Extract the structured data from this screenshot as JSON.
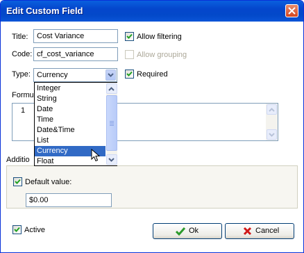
{
  "window": {
    "title": "Edit Custom Field"
  },
  "form": {
    "title_label": "Title:",
    "title_value": "Cost Variance",
    "code_label": "Code:",
    "code_value": "cf_cost_variance",
    "type_label": "Type:",
    "type_value": "Currency",
    "allow_filtering": {
      "label": "Allow filtering",
      "checked": true
    },
    "allow_grouping": {
      "label": "Allow grouping",
      "checked": false,
      "disabled": true
    },
    "required": {
      "label": "Required",
      "checked": true
    },
    "formula_label": "Formul",
    "formula_text": "1",
    "additional_label": "Additio",
    "default_value": {
      "label": "Default value:",
      "checked": true,
      "value": "$0.00"
    },
    "active": {
      "label": "Active",
      "checked": true
    }
  },
  "type_dropdown": {
    "options": [
      "Integer",
      "String",
      "Date",
      "Time",
      "Date&Time",
      "List",
      "Currency",
      "Float"
    ],
    "selected": "Currency"
  },
  "buttons": {
    "ok_label": "Ok",
    "cancel_label": "Cancel"
  },
  "colors": {
    "titlebar": "#0a5fde",
    "selection": "#316ac5",
    "ok_icon": "#2c9a2c",
    "cancel_icon": "#d01818"
  },
  "icons": [
    "close-icon",
    "checkmark-icon",
    "chevron-down-icon",
    "chevron-up-icon",
    "ok-check-icon",
    "cancel-x-icon",
    "mouse-cursor-icon"
  ]
}
